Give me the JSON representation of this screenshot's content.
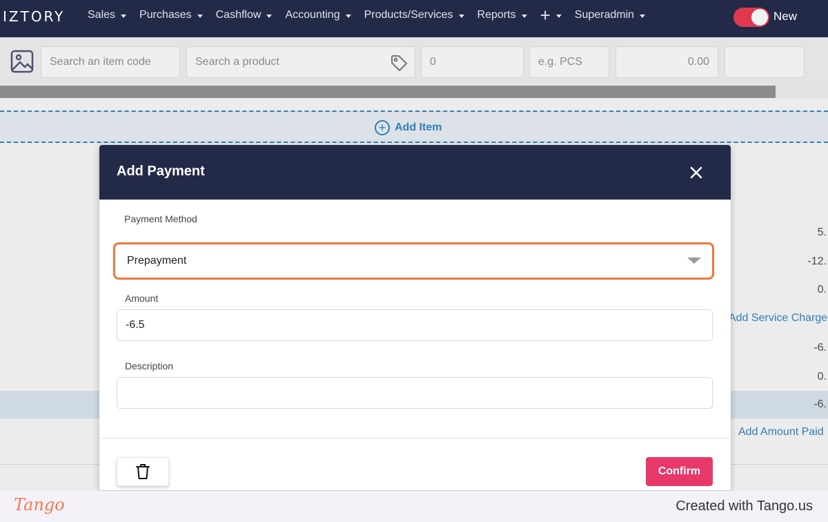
{
  "nav": {
    "logo": "IZTORY",
    "items": [
      "Sales",
      "Purchases",
      "Cashflow",
      "Accounting",
      "Products/Services",
      "Reports"
    ],
    "plus_label": "+",
    "user": "Superadmin",
    "toggle_label": "New",
    "toggle_color": "#e0394f"
  },
  "item_row": {
    "item_code_placeholder": "Search an item code",
    "product_placeholder": "Search a product",
    "qty_value": "0",
    "unit_placeholder": "e.g. PCS",
    "price_value": "0.00",
    "extra_value": ""
  },
  "add_item": {
    "label": "Add Item",
    "icon": "plus-circle-icon"
  },
  "background": {
    "values": [
      "5.",
      "-12.",
      "0.",
      "-6.",
      "0.",
      "-6."
    ],
    "add_service_charge": "Add Service Charge",
    "add_amount_paid": "Add Amount Paid"
  },
  "modal": {
    "title": "Add Payment",
    "payment_method_label": "Payment Method",
    "payment_method_value": "Prepayment",
    "amount_label": "Amount",
    "amount_value": "-6.5",
    "description_label": "Description",
    "description_value": "",
    "confirm_label": "Confirm",
    "accent_color": "#e8386a",
    "highlight_color": "#f27538"
  },
  "footer": {
    "logo": "Tango",
    "text": "Created with Tango.us"
  }
}
